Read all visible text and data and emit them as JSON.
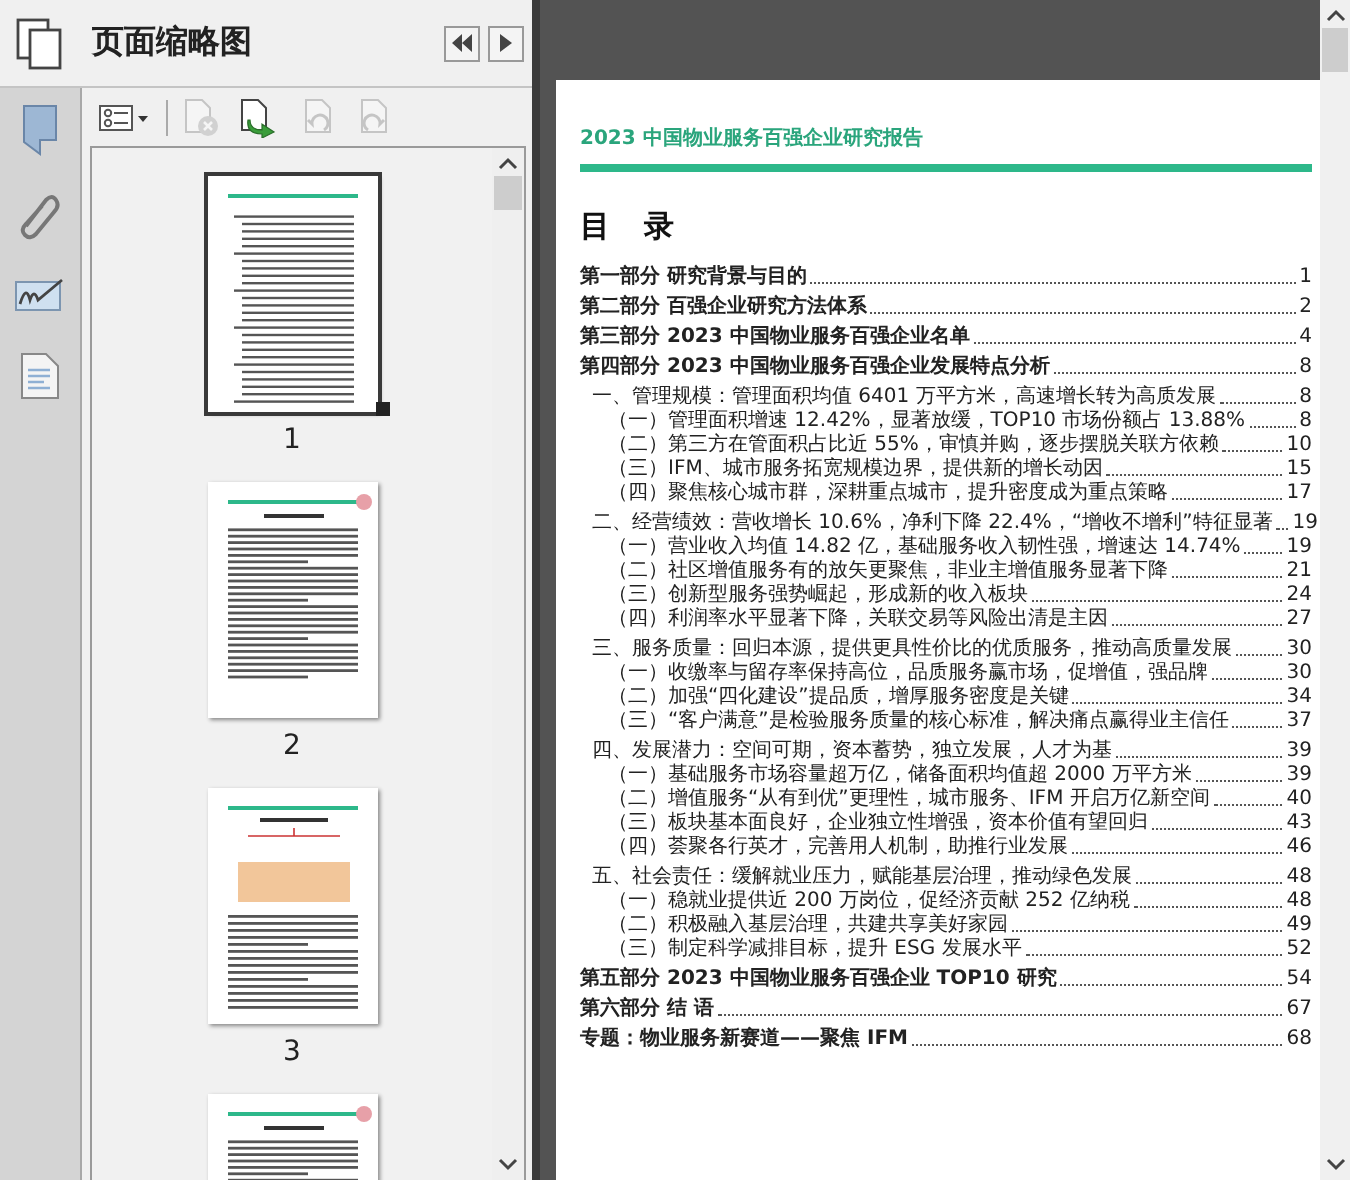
{
  "sidebar": {
    "title": "页面缩略图"
  },
  "toolbar": {
    "tools": [
      {
        "kind": "options",
        "disabled": false
      },
      {
        "kind": "delete",
        "disabled": true
      },
      {
        "kind": "insert",
        "disabled": false
      },
      {
        "kind": "rotate-left",
        "disabled": true
      },
      {
        "kind": "rotate-right",
        "disabled": true
      }
    ]
  },
  "thumbnails": [
    {
      "kind": "toc",
      "label": "1",
      "selected": true
    },
    {
      "kind": "text",
      "label": "2",
      "selected": false
    },
    {
      "kind": "diagram",
      "label": "3",
      "selected": false
    },
    {
      "kind": "text",
      "selected": false
    }
  ],
  "document": {
    "header": "2023 中国物业服务百强企业研究报告",
    "heading": "目 录",
    "toc": [
      {
        "title": "第一部分 研究背景与目的",
        "page": "1"
      },
      {
        "title": "第二部分 百强企业研究方法体系",
        "page": "2"
      },
      {
        "title": "第三部分 2023 中国物业服务百强企业名单",
        "page": "4"
      },
      {
        "title": "第四部分 2023 中国物业服务百强企业发展特点分析",
        "page": "8",
        "children": [
          {
            "title": "一、管理规模：管理面积均值 6401 万平方米，高速增长转为高质发展",
            "page": "8",
            "children": [
              {
                "title": "（一）管理面积增速 12.42%，显著放缓，TOP10 市场份额占 13.88%",
                "page": "8"
              },
              {
                "title": "（二）第三方在管面积占比近 55%，审慎并购，逐步摆脱关联方依赖",
                "page": "10"
              },
              {
                "title": "（三）IFM、城市服务拓宽规模边界，提供新的增长动因",
                "page": "15"
              },
              {
                "title": "（四）聚焦核心城市群，深耕重点城市，提升密度成为重点策略",
                "page": "17"
              }
            ]
          },
          {
            "title": "二、经营绩效：营收增长 10.6%，净利下降 22.4%，“增收不增利”特征显著",
            "page": "19",
            "children": [
              {
                "title": "（一）营业收入均值 14.82 亿，基础服务收入韧性强，增速达 14.74%",
                "page": "19"
              },
              {
                "title": "（二）社区增值服务有的放矢更聚焦，非业主增值服务显著下降",
                "page": "21"
              },
              {
                "title": "（三）创新型服务强势崛起，形成新的收入板块",
                "page": "24"
              },
              {
                "title": "（四）利润率水平显著下降，关联交易等风险出清是主因",
                "page": "27"
              }
            ]
          },
          {
            "title": "三、服务质量：回归本源，提供更具性价比的优质服务，推动高质量发展",
            "page": "30",
            "children": [
              {
                "title": "（一）收缴率与留存率保持高位，品质服务赢市场，促增值，强品牌",
                "page": "30"
              },
              {
                "title": "（二）加强“四化建设”提品质，增厚服务密度是关键",
                "page": "34"
              },
              {
                "title": "（三）“客户满意”是检验服务质量的核心标准，解决痛点赢得业主信任",
                "page": "37"
              }
            ]
          },
          {
            "title": "四、发展潜力：空间可期，资本蓄势，独立发展，人才为基",
            "page": "39",
            "children": [
              {
                "title": "（一）基础服务市场容量超万亿，储备面积均值超 2000 万平方米",
                "page": "39"
              },
              {
                "title": "（二）增值服务“从有到优”更理性，城市服务、IFM 开启万亿新空间",
                "page": "40"
              },
              {
                "title": "（三）板块基本面良好，企业独立性增强，资本价值有望回归",
                "page": "43"
              },
              {
                "title": "（四）荟聚各行英才，完善用人机制，助推行业发展",
                "page": "46"
              }
            ]
          },
          {
            "title": "五、社会责任：缓解就业压力，赋能基层治理，推动绿色发展",
            "page": "48",
            "children": [
              {
                "title": "（一）稳就业提供近 200 万岗位，促经济贡献 252 亿纳税",
                "page": "48"
              },
              {
                "title": "（二）积极融入基层治理，共建共享美好家园",
                "page": "49"
              },
              {
                "title": "（三）制定科学减排目标，提升 ESG 发展水平",
                "page": "52"
              }
            ]
          }
        ]
      },
      {
        "title": "第五部分 2023 中国物业服务百强企业 TOP10 研究",
        "page": "54"
      },
      {
        "title": "第六部分 结 语",
        "page": "67"
      },
      {
        "title": "专题：物业服务新赛道——聚焦 IFM",
        "page": "68"
      }
    ]
  }
}
